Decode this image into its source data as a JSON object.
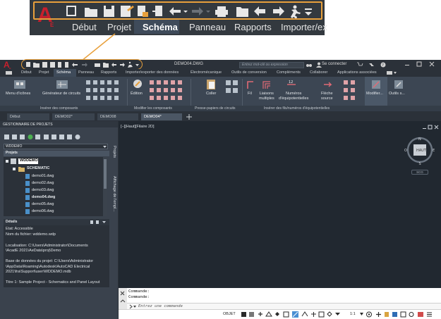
{
  "zoom_callout": {
    "tabs": [
      {
        "label": "Début",
        "active": false
      },
      {
        "label": "Projet",
        "active": false
      },
      {
        "label": "Schéma",
        "active": true
      },
      {
        "label": "Panneau",
        "active": false
      },
      {
        "label": "Rapports",
        "active": false
      },
      {
        "label": "Importer/ex",
        "active": false
      }
    ],
    "highlight_color": "#e8a03c"
  },
  "titlebar": {
    "title": "DEMO04.DWG",
    "search_placeholder": "Entrez mot-clé ou expression",
    "user_label": "Se connecter",
    "logo_letter": "A",
    "logo_sub": "E"
  },
  "ribbon_tabs": [
    {
      "label": "Début",
      "active": false
    },
    {
      "label": "Projet",
      "active": false
    },
    {
      "label": "Schéma",
      "active": true
    },
    {
      "label": "Panneau",
      "active": false
    },
    {
      "label": "Rapports",
      "active": false
    },
    {
      "label": "Importer/exporter des données",
      "active": false
    },
    {
      "label": "Électromécanique",
      "active": false
    },
    {
      "label": "Outils de conversion",
      "active": false
    },
    {
      "label": "Compléments",
      "active": false
    },
    {
      "label": "Collaborer",
      "active": false
    },
    {
      "label": "Applications associées",
      "active": false
    }
  ],
  "ribbon": {
    "menu_icones": "Menu d'icônes",
    "generateur": "Générateur de circuits",
    "edition": "Édition",
    "coller": "Coller",
    "fil": "Fil",
    "liaisons": "Liaisons\nmultiples",
    "numeros": "Numéros\nd'équipotentielles",
    "fleche": "Flèche\nsource",
    "modifier": "Modifier...",
    "outils": "Outils s...",
    "groups": [
      "Insérer des composants",
      "Modifier les composants",
      "Presse-papiers de circuits",
      "Insérer des fils/numéros d'équipotentielles"
    ]
  },
  "doc_tabs": [
    {
      "label": "Début",
      "active": false
    },
    {
      "label": "DEMO02*",
      "active": false
    },
    {
      "label": "DEMO08",
      "active": false
    },
    {
      "label": "DEMO04*",
      "active": true
    }
  ],
  "project_manager": {
    "title": "GESTIONNAIRE DE PROJETS",
    "selected_project": "WDDEMO",
    "projects_header": "Projets",
    "tree": {
      "root": "WDDEMO",
      "folder": "SCHEMATIC",
      "files": [
        {
          "name": "demo01.dwg",
          "bold": false
        },
        {
          "name": "demo02.dwg",
          "bold": false
        },
        {
          "name": "demo03.dwg",
          "bold": false
        },
        {
          "name": "demo04.dwg",
          "bold": true
        },
        {
          "name": "demo05.dwg",
          "bold": false
        },
        {
          "name": "demo06.dwg",
          "bold": false
        }
      ]
    },
    "side_tabs": [
      "Projets",
      "Affichage de l'empl..."
    ],
    "details_header": "Détails",
    "details": [
      "Etat: Accessible",
      "Nom du fichier: wddemo.wdp",
      "",
      "Localisation: C:\\Users\\Administrator\\Documents",
      "\\AcadE 2021\\AeData\\proj\\Demo",
      "",
      "Base de données du projet: C:\\Users\\Administrator",
      "\\AppData\\Roaming\\Autodesk\\AutoCAD Electrical",
      "2021\\fra\\Support\\user\\WDDEMO.mdb",
      "",
      "Titre 1: Sample Project - Schematics and Panel Layout"
    ]
  },
  "viewport": {
    "label": "[−][Haut][Filaire 2D]",
    "viewcube": {
      "face": "HAUT",
      "n": "N",
      "s": "S",
      "e": "E",
      "o": "O"
    },
    "wcs": "SCG"
  },
  "command": {
    "lines": [
      "Commande:",
      "Commande:"
    ],
    "placeholder": "Entrez une commande"
  },
  "status": {
    "model": "OBJET",
    "scale": "1:1"
  }
}
